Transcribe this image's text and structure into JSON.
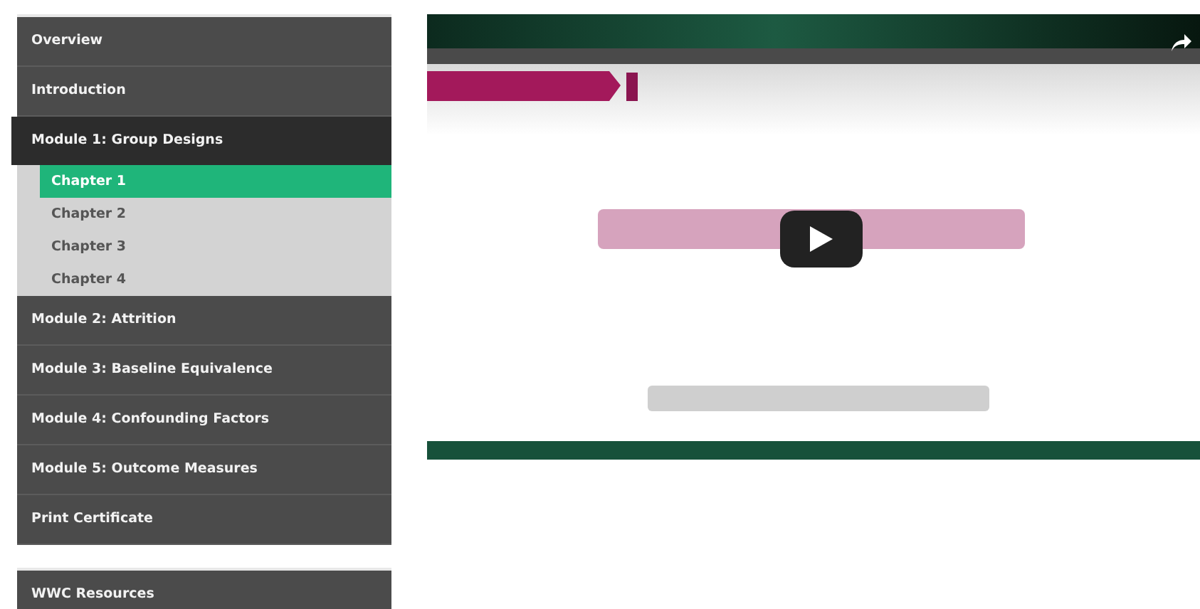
{
  "sidebar": {
    "items": [
      {
        "label": "Overview",
        "expanded": false,
        "selected": false
      },
      {
        "label": "Introduction",
        "expanded": false,
        "selected": false
      },
      {
        "label": "Module 1: Group Designs",
        "expanded": true,
        "selected": false,
        "children": [
          {
            "label": "Chapter 1",
            "selected": true
          },
          {
            "label": "Chapter 2",
            "selected": false
          },
          {
            "label": "Chapter 3",
            "selected": false
          },
          {
            "label": "Chapter 4",
            "selected": false
          }
        ]
      },
      {
        "label": "Module 2: Attrition",
        "expanded": false,
        "selected": false
      },
      {
        "label": "Module 3: Baseline Equivalence",
        "expanded": false,
        "selected": false
      },
      {
        "label": "Module 4: Confounding Factors",
        "expanded": false,
        "selected": false
      },
      {
        "label": "Module 5: Outcome Measures",
        "expanded": false,
        "selected": false
      },
      {
        "label": "Print Certificate",
        "expanded": false,
        "selected": false
      }
    ]
  },
  "resources": {
    "label": "WWC Resources"
  }
}
